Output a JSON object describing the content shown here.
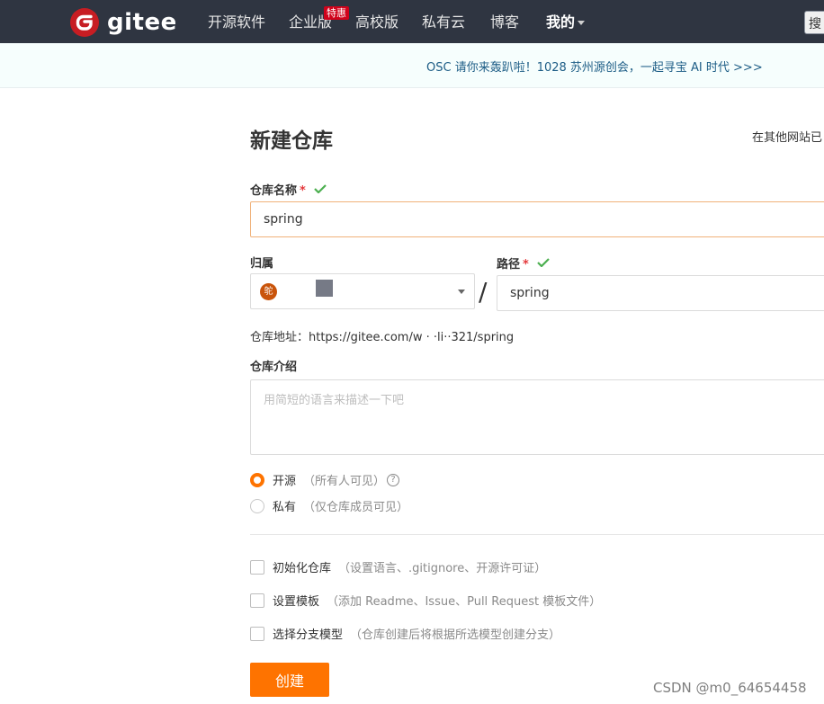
{
  "nav": {
    "brand": "gitee",
    "items": [
      "开源软件",
      "企业版",
      "高校版",
      "私有云",
      "博客",
      "我的"
    ],
    "badge": "特惠",
    "search_partial": "搜"
  },
  "announcement": {
    "text": "OSC 请你来轰趴啦！1028 苏州源创会，一起寻宝 AI 时代 >>>"
  },
  "form": {
    "title": "新建仓库",
    "import_link": "在其他网站已",
    "repo_name": {
      "label": "仓库名称",
      "required_mark": "*",
      "value": "spring"
    },
    "owner": {
      "label": "归属",
      "avatar_text": "鸵"
    },
    "path": {
      "label": "路径",
      "required_mark": "*",
      "value": "spring"
    },
    "separator": "/",
    "address": "仓库地址：https://gitee.com/w     ·   ·li··321/spring",
    "intro": {
      "label": "仓库介绍",
      "placeholder": "用简短的语言来描述一下吧"
    },
    "visibility": [
      {
        "label": "开源",
        "hint": "（所有人可见）",
        "selected": true
      },
      {
        "label": "私有",
        "hint": "（仅仓库成员可见）",
        "selected": false
      }
    ],
    "help_glyph": "?",
    "options": [
      {
        "label": "初始化仓库",
        "hint": "（设置语言、.gitignore、开源许可证）",
        "checked": false
      },
      {
        "label": "设置模板",
        "hint": "（添加 Readme、Issue、Pull Request 模板文件）",
        "checked": false
      },
      {
        "label": "选择分支模型",
        "hint": "（仓库创建后将根据所选模型创建分支）",
        "checked": false
      }
    ],
    "submit_label": "创建"
  },
  "watermark": "CSDN @m0_64654458",
  "colors": {
    "accent": "#fe7300",
    "nav_bg": "#2f3541",
    "brand_red": "#c71d23",
    "success": "#4caf50"
  }
}
